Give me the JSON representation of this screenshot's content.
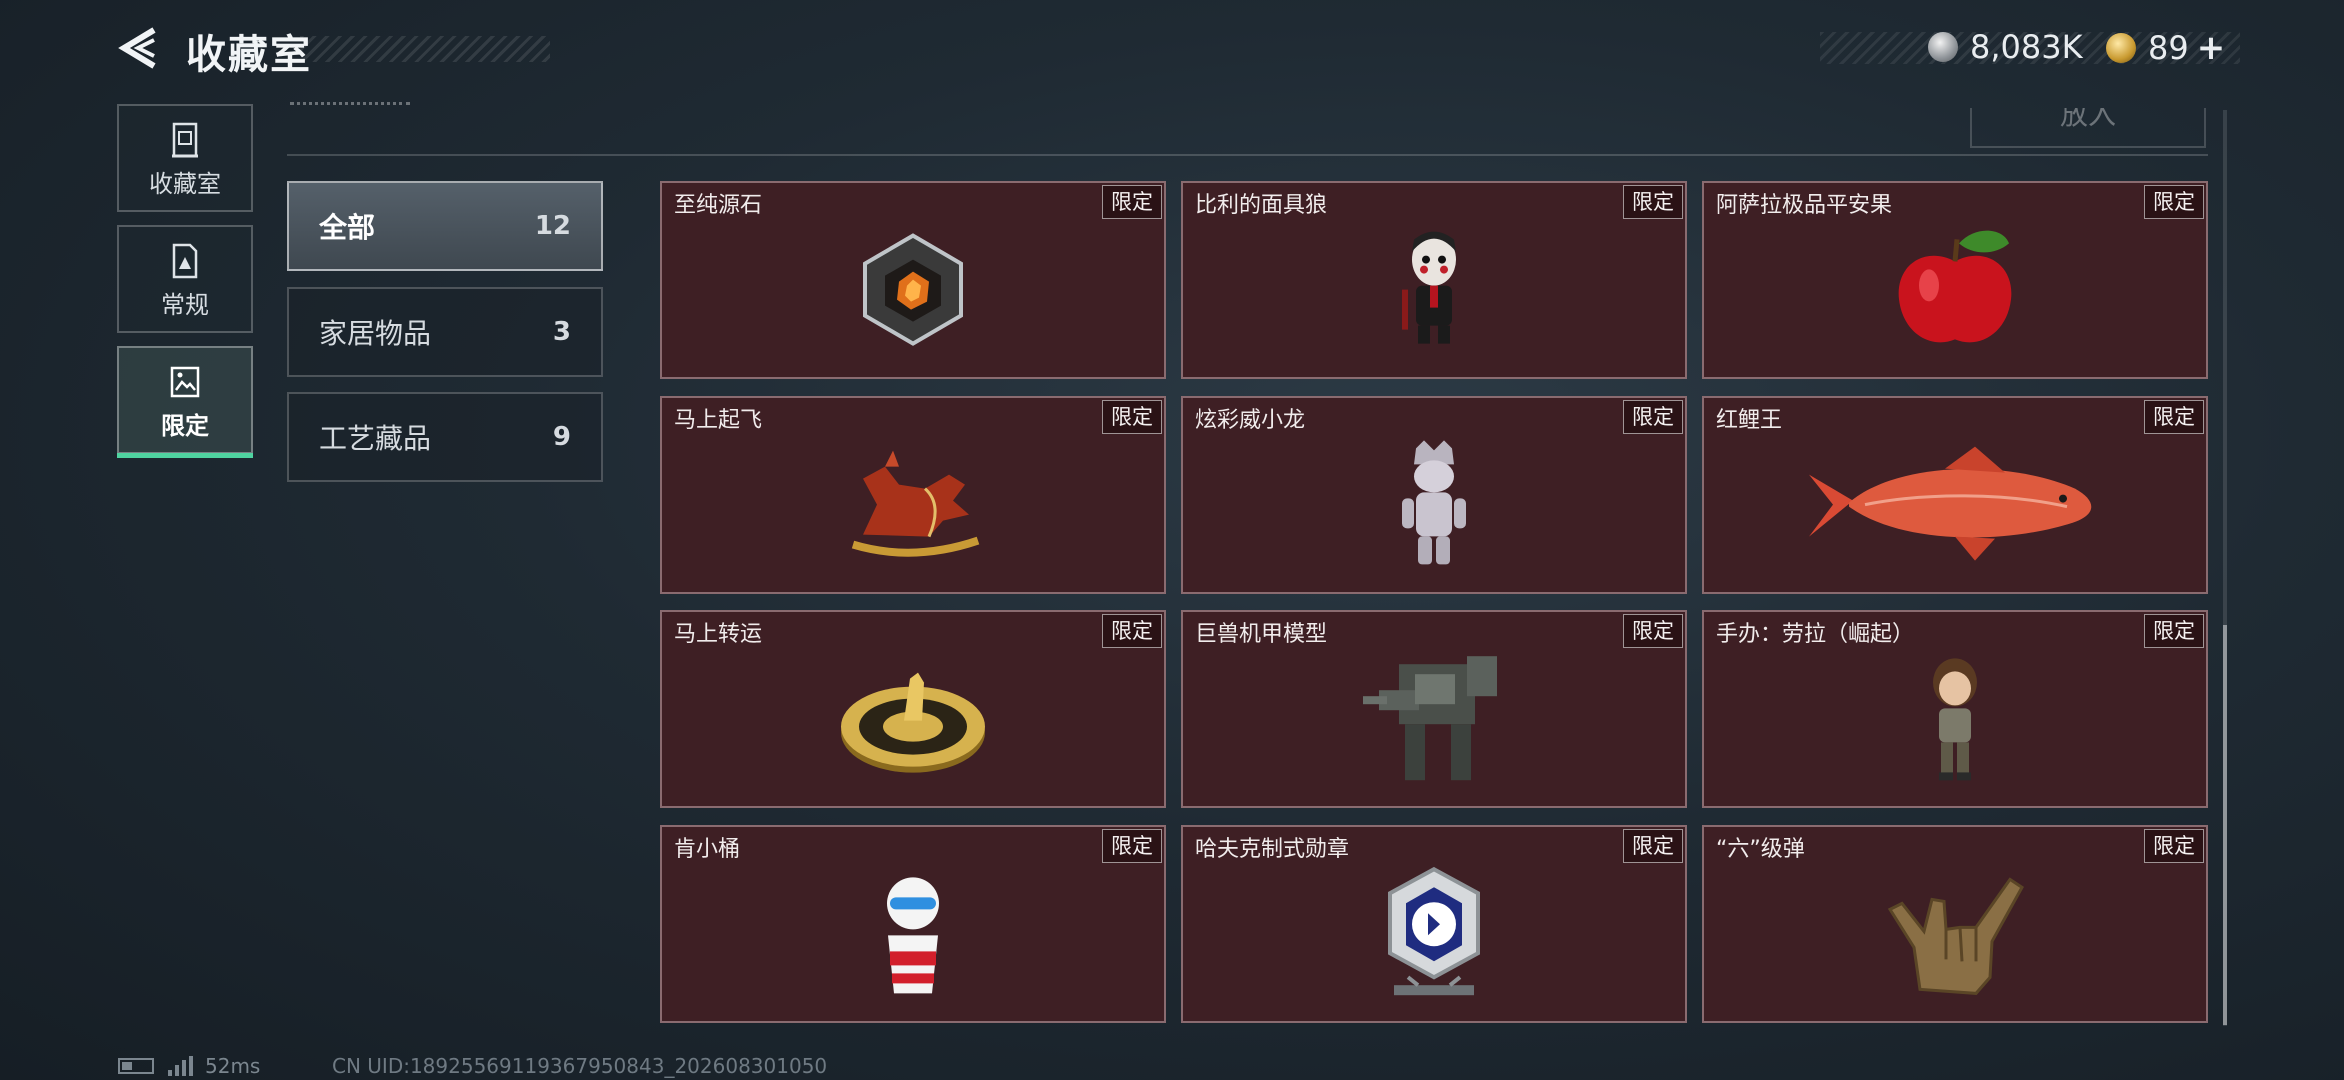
{
  "header": {
    "title": "收藏室",
    "back_icon": "back-arrow-icon",
    "currencies": [
      {
        "icon": "silver-coin-icon",
        "value": "8,083K"
      },
      {
        "icon": "gold-coin-icon",
        "value": "89"
      }
    ],
    "plus": "+"
  },
  "nav": [
    {
      "label": "收藏室",
      "icon": "cabinet-icon",
      "active": false
    },
    {
      "label": "常规",
      "icon": "document-icon",
      "active": false
    },
    {
      "label": "限定",
      "icon": "picture-icon",
      "active": true
    }
  ],
  "top_button": "放入",
  "categories": [
    {
      "name": "全部",
      "count": "12",
      "active": true
    },
    {
      "name": "家居物品",
      "count": "3",
      "active": false
    },
    {
      "name": "工艺藏品",
      "count": "9",
      "active": false
    }
  ],
  "items": [
    {
      "name": "至纯源石",
      "badge": "限定",
      "icon": "gem-icon"
    },
    {
      "name": "比利的面具狼",
      "badge": "限定",
      "icon": "puppet-figure-icon"
    },
    {
      "name": "阿萨拉极品平安果",
      "badge": "限定",
      "icon": "apple-icon"
    },
    {
      "name": "马上起飞",
      "badge": "限定",
      "icon": "horse-statue-icon"
    },
    {
      "name": "炫彩威小龙",
      "badge": "限定",
      "icon": "dragon-figure-icon"
    },
    {
      "name": "红鲤王",
      "badge": "限定",
      "icon": "carp-fish-icon"
    },
    {
      "name": "马上转运",
      "badge": "限定",
      "icon": "gold-disc-icon"
    },
    {
      "name": "巨兽机甲模型",
      "badge": "限定",
      "icon": "mech-model-icon"
    },
    {
      "name": "手办：劳拉（崛起）",
      "badge": "限定",
      "icon": "figurine-icon"
    },
    {
      "name": "肯小桶",
      "badge": "限定",
      "icon": "bucket-mascot-icon"
    },
    {
      "name": "哈夫克制式勋章",
      "badge": "限定",
      "icon": "medal-icon"
    },
    {
      "name": "“六”级弹",
      "badge": "限定",
      "icon": "hand-gesture-icon"
    }
  ],
  "status": {
    "ping": "52ms",
    "uid": "CN UID:18925569119367950843_202608301050"
  },
  "colors": {
    "card_bg": "#3e1f24",
    "active_tab_underline": "#4fd3a0",
    "background": "#1f2a33"
  }
}
